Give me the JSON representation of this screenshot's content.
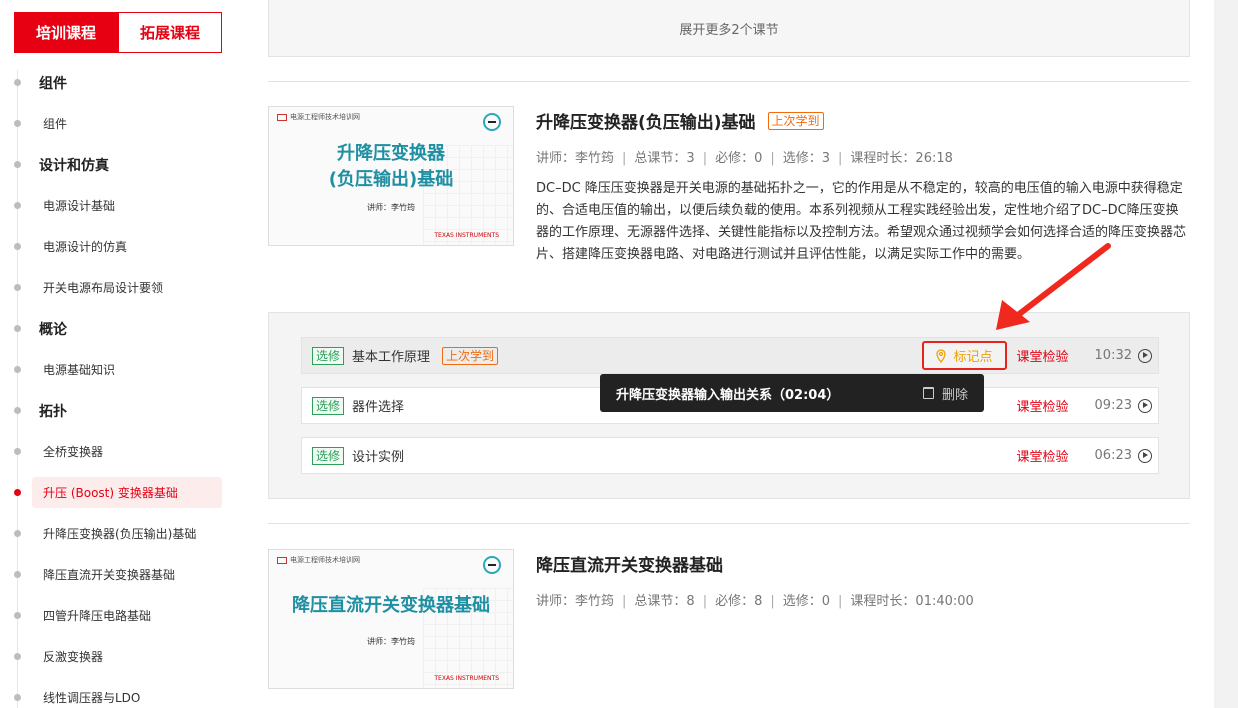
{
  "sidebar": {
    "tabs": [
      {
        "label": "培训课程",
        "active": true
      },
      {
        "label": "拓展课程",
        "active": false
      }
    ],
    "items": [
      {
        "label": "组件",
        "type": "group"
      },
      {
        "label": "组件",
        "type": "sub"
      },
      {
        "label": "设计和仿真",
        "type": "group"
      },
      {
        "label": "电源设计基础",
        "type": "sub"
      },
      {
        "label": "电源设计的仿真",
        "type": "sub"
      },
      {
        "label": "开关电源布局设计要领",
        "type": "sub"
      },
      {
        "label": "概论",
        "type": "group"
      },
      {
        "label": "电源基础知识",
        "type": "sub"
      },
      {
        "label": "拓扑",
        "type": "group"
      },
      {
        "label": "全桥变换器",
        "type": "sub"
      },
      {
        "label": "升压 (Boost) 变换器基础",
        "type": "sub",
        "active": true
      },
      {
        "label": "升降压变换器(负压输出)基础",
        "type": "sub"
      },
      {
        "label": "降压直流开关变换器基础",
        "type": "sub"
      },
      {
        "label": "四管升降压电路基础",
        "type": "sub"
      },
      {
        "label": "反激变换器",
        "type": "sub"
      },
      {
        "label": "线性调压器与LDO",
        "type": "sub"
      }
    ]
  },
  "main": {
    "expand_label": "展开更多2个课节",
    "courses": [
      {
        "title": "升降压变换器(负压输出)基础",
        "badge": "上次学到",
        "thumb": {
          "header": "电源工程师技术培训网",
          "title_line1": "升降压变换器",
          "title_line2": "(负压输出)基础",
          "teacher": "讲师：李竹筠",
          "brand": "TEXAS INSTRUMENTS"
        },
        "meta": {
          "teacher": "讲师：李竹筠",
          "total": "总课节：3",
          "required": "必修：0",
          "elective": "选修：3",
          "duration": "课程时长：26:18"
        },
        "description": "DC–DC 降压压变换器是开关电源的基础拓扑之一，它的作用是从不稳定的，较高的电压值的输入电源中获得稳定的、合适电压值的输出，以便后续负载的使用。本系列视频从工程实践经验出发，定性地介绍了DC–DC降压变换器的工作原理、无源器件选择、关键性能指标以及控制方法。希望观众通过视频学会如何选择合适的降压变换器芯片、搭建降压变换器电路、对电路进行测试并且评估性能，以满足实际工作中的需要。",
        "lessons": [
          {
            "tag": "选修",
            "title": "基本工作原理",
            "badge": "上次学到",
            "mark_label": "标记点",
            "quiz": "课堂检验",
            "duration": "10:32"
          },
          {
            "tag": "选修",
            "title": "器件选择",
            "quiz": "课堂检验",
            "duration": "09:23"
          },
          {
            "tag": "选修",
            "title": "设计实例",
            "quiz": "课堂检验",
            "duration": "06:23"
          }
        ]
      },
      {
        "title": "降压直流开关变换器基础",
        "thumb": {
          "header": "电源工程师技术培训网",
          "title_line1": "降压直流开关变换器基础",
          "teacher": "讲师：李竹筠",
          "brand": "TEXAS INSTRUMENTS"
        },
        "meta": {
          "teacher": "讲师：李竹筠",
          "total": "总课节：8",
          "required": "必修：8",
          "elective": "选修：0",
          "duration": "课程时长：01:40:00"
        }
      }
    ],
    "tooltip": {
      "text": "升降压变换器输入输出关系（02:04）",
      "delete_label": "删除"
    }
  },
  "colors": {
    "brand_red": "#e60012",
    "badge_orange": "#f26b0f",
    "elective_green": "#2e9e5b",
    "thumb_teal": "#1f8fa3"
  },
  "icons": [
    "location-pin-icon",
    "play-circle-icon",
    "trash-icon",
    "red-arrow-annotation"
  ]
}
